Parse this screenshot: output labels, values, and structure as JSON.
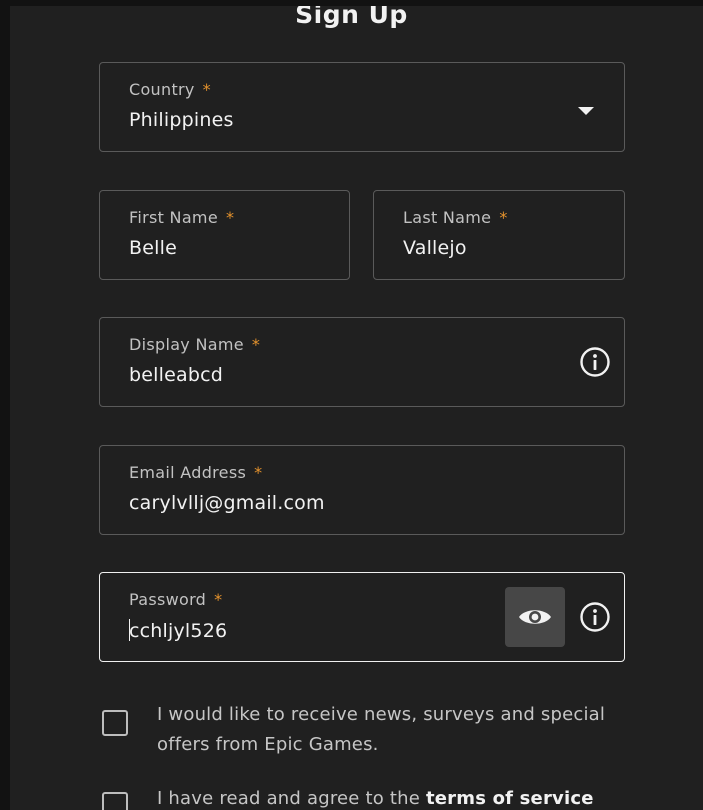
{
  "title": "Sign Up",
  "required_mark": "*",
  "fields": {
    "country": {
      "label": "Country",
      "value": "Philippines"
    },
    "first_name": {
      "label": "First Name",
      "value": "Belle"
    },
    "last_name": {
      "label": "Last Name",
      "value": "Vallejo"
    },
    "display_name": {
      "label": "Display Name",
      "value": "belleabcd"
    },
    "email": {
      "label": "Email Address",
      "value": "carylvllj@gmail.com"
    },
    "password": {
      "label": "Password",
      "value": "cchljyl526"
    }
  },
  "checkboxes": {
    "news": {
      "text": "I would like to receive news, surveys and special offers from Epic Games.",
      "checked": false
    },
    "terms": {
      "text_prefix": "I have read and agree to the ",
      "link_text": "terms of service",
      "checked": false
    }
  },
  "icons": {
    "dropdown": "chevron-down-icon",
    "info": "info-icon",
    "eye": "eye-icon"
  },
  "colors": {
    "background": "#202020",
    "required": "#e5932d",
    "border": "#5a5a5a",
    "focus_border": "#f0f0f0",
    "eye_button": "#474747"
  }
}
